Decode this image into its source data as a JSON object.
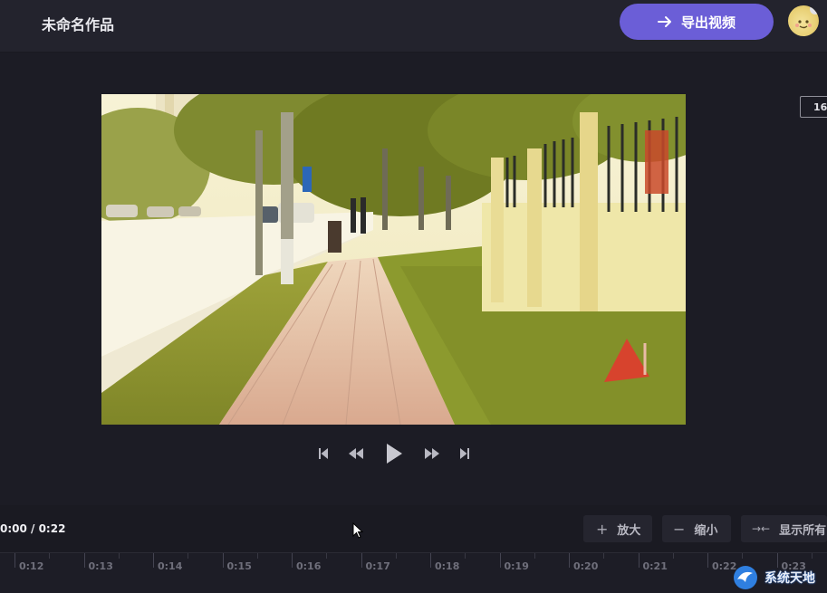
{
  "header": {
    "title": "未命名作品",
    "export_label": "导出视频"
  },
  "player": {
    "aspect_ratio": "16:"
  },
  "timeline": {
    "timecode": "0:00 / 0:22",
    "zoom_in": "放大",
    "zoom_out": "缩小",
    "show_all": "显示所有",
    "ticks": [
      "0:12",
      "0:13",
      "0:14",
      "0:15",
      "0:16",
      "0:17",
      "0:18",
      "0:19",
      "0:20",
      "0:21",
      "0:22",
      "0:23"
    ]
  },
  "watermark": {
    "text": "系统天地"
  },
  "colors": {
    "accent": "#6b5ed7",
    "background": "#1b1b24",
    "header": "#23232d"
  }
}
